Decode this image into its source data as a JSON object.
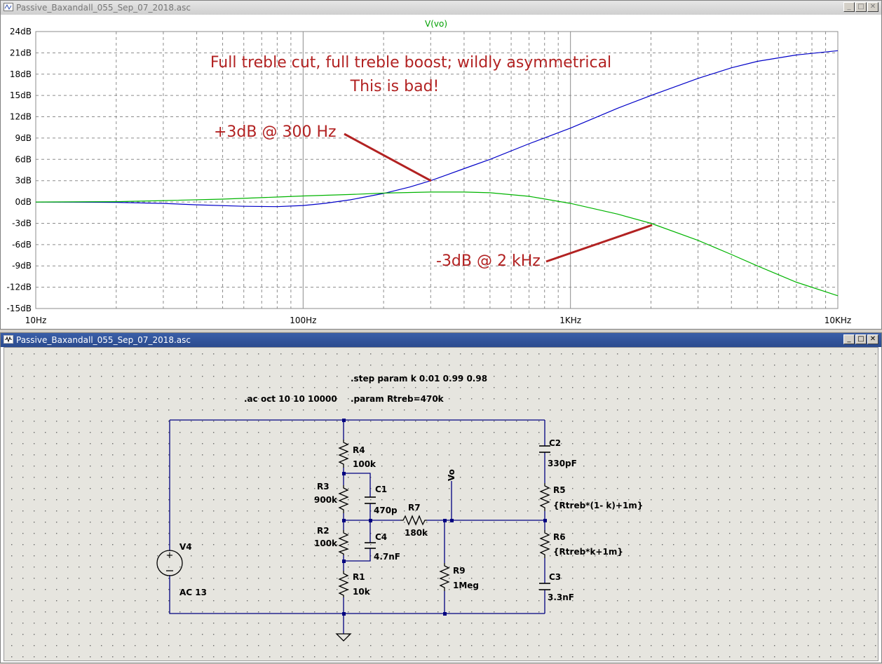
{
  "plot_window": {
    "title": "Passive_Baxandall_055_Sep_07_2018.asc",
    "trace_label": "V(vo)",
    "annotation_line1": "Full treble cut, full treble boost; wildly asymmetrical",
    "annotation_line2": "This is bad!",
    "label_boost": "+3dB @ 300 Hz",
    "label_cut": "-3dB @ 2 kHz"
  },
  "schematic_window": {
    "title": "Passive_Baxandall_055_Sep_07_2018.asc",
    "directives": {
      "step": ".step param k 0.01 0.99 0.98",
      "ac": ".ac oct 10 10 10000",
      "param": ".param Rtreb=470k"
    },
    "components": {
      "R4": {
        "name": "R4",
        "value": "100k"
      },
      "R3": {
        "name": "R3",
        "value": "900k"
      },
      "R2": {
        "name": "R2",
        "value": "100k"
      },
      "R1": {
        "name": "R1",
        "value": "10k"
      },
      "C1": {
        "name": "C1",
        "value": "470p"
      },
      "C4": {
        "name": "C4",
        "value": "4.7nF"
      },
      "R7": {
        "name": "R7",
        "value": "180k"
      },
      "R9": {
        "name": "R9",
        "value": "1Meg"
      },
      "C2": {
        "name": "C2",
        "value": "330pF"
      },
      "R5": {
        "name": "R5",
        "value": "{Rtreb*(1- k)+1m}"
      },
      "R6": {
        "name": "R6",
        "value": "{Rtreb*k+1m}"
      },
      "C3": {
        "name": "C3",
        "value": "3.3nF"
      },
      "V4": {
        "name": "V4",
        "value": "AC 13"
      }
    },
    "net_label": "Vo"
  },
  "colors": {
    "trace_boost": "#0000c8",
    "trace_cut": "#00b400",
    "annotation": "#b22222",
    "wire": "#000080",
    "grid": "#8c8c8c"
  },
  "chart_data": {
    "type": "line",
    "title": "V(vo)",
    "xlabel": "",
    "ylabel": "",
    "x_scale": "log",
    "xlim": [
      10,
      10000
    ],
    "ylim": [
      -15,
      24
    ],
    "x_ticks": [
      "10Hz",
      "100Hz",
      "1KHz",
      "10KHz"
    ],
    "y_ticks": [
      "24dB",
      "21dB",
      "18dB",
      "15dB",
      "12dB",
      "9dB",
      "6dB",
      "3dB",
      "0dB",
      "-3dB",
      "-6dB",
      "-9dB",
      "-12dB",
      "-15dB"
    ],
    "grid": true,
    "series": [
      {
        "color": "#0000c8",
        "x": [
          10,
          20,
          30,
          40,
          60,
          80,
          100,
          120,
          150,
          200,
          250,
          300,
          400,
          500,
          700,
          1000,
          1500,
          2000,
          3000,
          4000,
          5000,
          7000,
          10000
        ],
        "y": [
          0,
          -0.05,
          -0.2,
          -0.4,
          -0.6,
          -0.65,
          -0.5,
          -0.2,
          0.3,
          1.2,
          2.1,
          3.0,
          4.7,
          6.0,
          8.2,
          10.4,
          13.2,
          15.0,
          17.4,
          18.9,
          19.8,
          20.7,
          21.3
        ]
      },
      {
        "color": "#00b400",
        "x": [
          10,
          20,
          30,
          50,
          80,
          100,
          150,
          200,
          300,
          400,
          500,
          700,
          1000,
          1500,
          2000,
          3000,
          4000,
          5000,
          7000,
          10000
        ],
        "y": [
          0,
          0.05,
          0.2,
          0.4,
          0.7,
          0.85,
          1.05,
          1.25,
          1.4,
          1.4,
          1.3,
          0.8,
          -0.2,
          -1.7,
          -3.0,
          -5.4,
          -7.4,
          -9.0,
          -11.3,
          -13.2
        ]
      }
    ],
    "annotations": [
      "Full treble cut, full treble boost; wildly asymmetrical",
      "This is bad!",
      "+3dB @ 300 Hz",
      "-3dB @ 2 kHz"
    ]
  }
}
